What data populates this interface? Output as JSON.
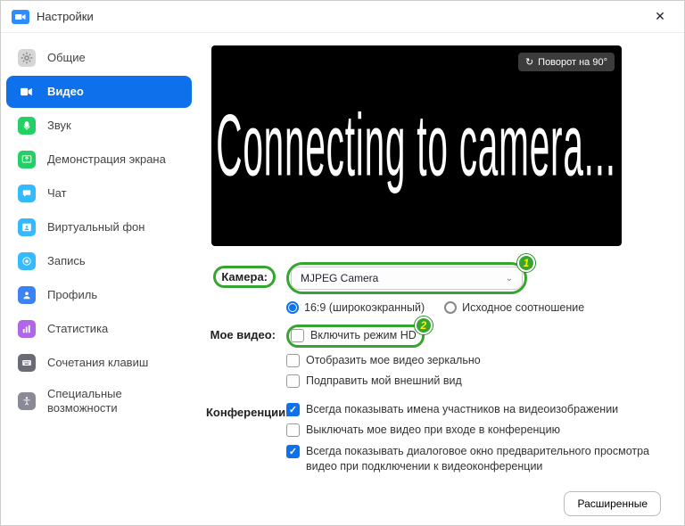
{
  "window": {
    "title": "Настройки"
  },
  "sidebar": {
    "items": [
      {
        "id": "general",
        "label": "Общие",
        "color": "#d6d6d8",
        "glyph": "gear"
      },
      {
        "id": "video",
        "label": "Видео",
        "color": "#0e71eb",
        "glyph": "video",
        "active": true
      },
      {
        "id": "audio",
        "label": "Звук",
        "color": "#24d065",
        "glyph": "audio"
      },
      {
        "id": "share",
        "label": "Демонстрация экрана",
        "color": "#24d065",
        "glyph": "share"
      },
      {
        "id": "chat",
        "label": "Чат",
        "color": "#35b9ff",
        "glyph": "chat"
      },
      {
        "id": "vbg",
        "label": "Виртуальный фон",
        "color": "#35b9ff",
        "glyph": "vbg"
      },
      {
        "id": "rec",
        "label": "Запись",
        "color": "#35b9ff",
        "glyph": "rec"
      },
      {
        "id": "profile",
        "label": "Профиль",
        "color": "#3b82f6",
        "glyph": "profile"
      },
      {
        "id": "stats",
        "label": "Статистика",
        "color": "#b066e8",
        "glyph": "stats"
      },
      {
        "id": "keys",
        "label": "Сочетания клавиш",
        "color": "#6b6b78",
        "glyph": "keys"
      },
      {
        "id": "access",
        "label": "Специальные возможности",
        "color": "#8a8a96",
        "glyph": "access"
      }
    ]
  },
  "preview": {
    "rotate_label": "Поворот на 90°",
    "status_text": "Connecting to camera..."
  },
  "camera": {
    "label": "Камера:",
    "selected": "MJPEG Camera",
    "ratio_wide": "16:9 (широкоэкранный)",
    "ratio_orig": "Исходное соотношение",
    "badge": "1"
  },
  "my_video": {
    "label": "Мое видео:",
    "hd": "Включить режим HD",
    "mirror": "Отобразить мое видео зеркально",
    "touch_up": "Подправить мой внешний вид",
    "badge": "2"
  },
  "conference": {
    "label": "Конференции:",
    "names": "Всегда показывать имена участников на видеоизображении",
    "mute_video": "Выключать мое видео при входе в конференцию",
    "preview": "Всегда показывать диалоговое окно предварительного просмотра видео при подключении к видеоконференции"
  },
  "advanced_label": "Расширенные"
}
